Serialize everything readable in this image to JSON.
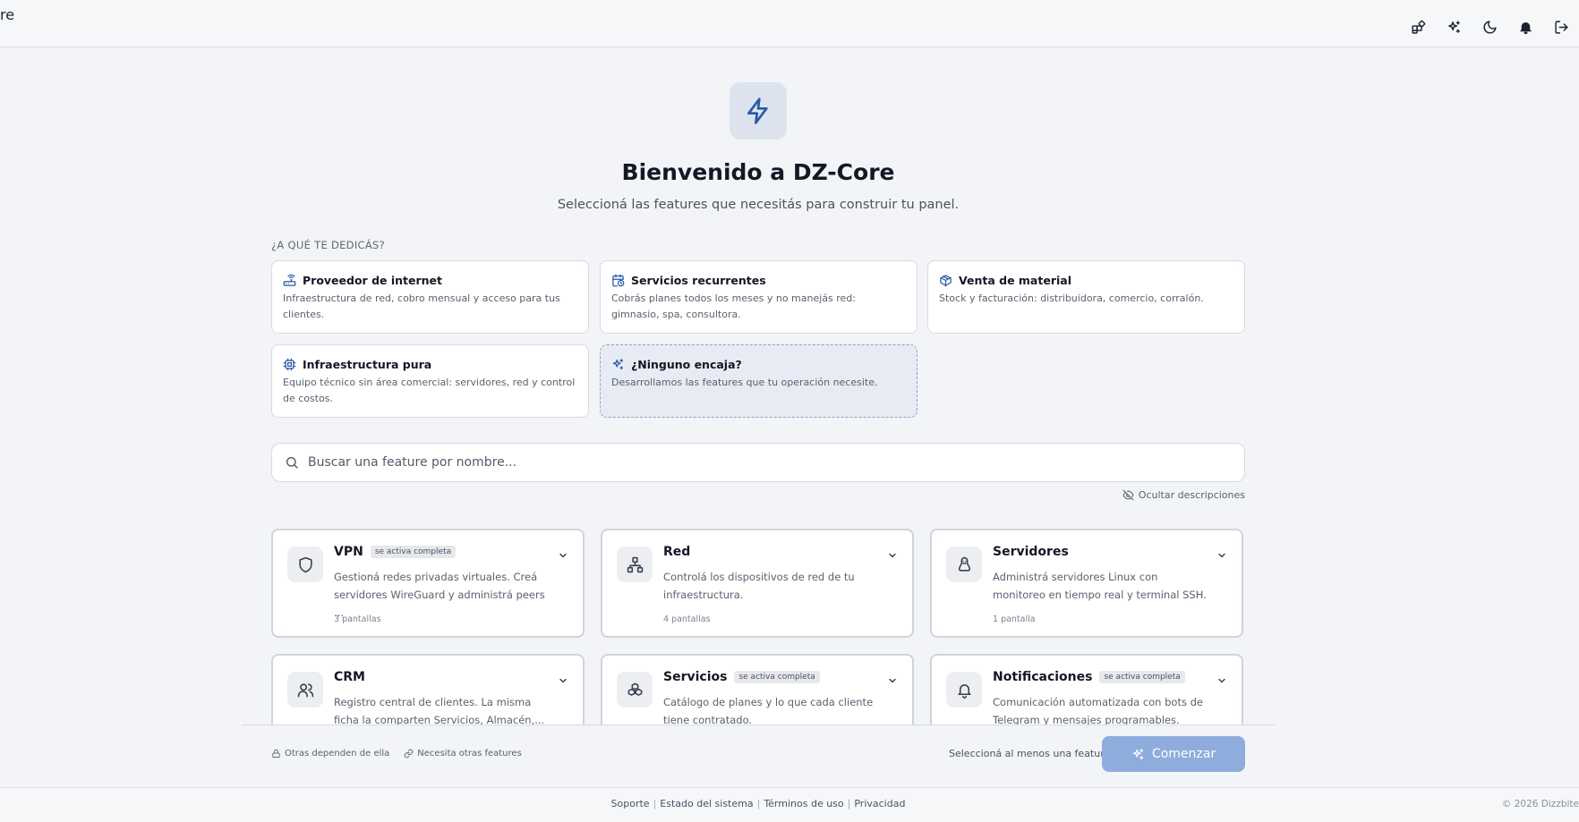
{
  "header": {
    "brand_fragment": "re",
    "icons": [
      "grid-icon",
      "sparkles-icon",
      "moon-icon",
      "bell-icon",
      "logout-icon"
    ]
  },
  "hero": {
    "icon": "bolt-icon",
    "title": "Bienvenido a DZ-Core",
    "subtitle": "Seleccioná las features que necesitás para construir tu panel."
  },
  "use_cases": {
    "label": "¿A QUÉ TE DEDICÁS?",
    "items": [
      {
        "title": "Proveedor de internet",
        "desc": "Infraestructura de red, cobro mensual y acceso para tus clientes.",
        "icon": "router-icon"
      },
      {
        "title": "Servicios recurrentes",
        "desc": "Cobrás planes todos los meses y no manejás red: gimnasio, spa, consultora.",
        "icon": "calendar-clock-icon"
      },
      {
        "title": "Venta de material",
        "desc": "Stock y facturación: distribuidora, comercio, corralón.",
        "icon": "package-icon"
      },
      {
        "title": "Infraestructura pura",
        "desc": "Equipo técnico sin área comercial: servidores, red y control de costos.",
        "icon": "chip-icon"
      },
      {
        "title": "¿Ninguno encaja?",
        "desc": "Desarrollamos las features que tu operación necesite.",
        "icon": "sparkles-icon"
      }
    ]
  },
  "search": {
    "placeholder": "Buscar una feature por nombre..."
  },
  "toggle_descriptions": "Ocultar descripciones",
  "features": [
    {
      "name": "VPN",
      "badge": "se activa completa",
      "desc": "Gestioná redes privadas virtuales. Creá servidores WireGuard y administrá peers ...",
      "count": "3 pantallas",
      "icon": "shield-icon"
    },
    {
      "name": "Red",
      "badge": "",
      "desc": "Controlá los dispositivos de red de tu infraestructura.",
      "count": "4 pantallas",
      "icon": "network-icon"
    },
    {
      "name": "Servidores",
      "badge": "",
      "desc": "Administrá servidores Linux con monitoreo en tiempo real y terminal SSH.",
      "count": "1 pantalla",
      "icon": "linux-icon"
    },
    {
      "name": "CRM",
      "badge": "",
      "desc": "Registro central de clientes. La misma ficha la comparten Servicios, Almacén,...",
      "count": "",
      "icon": "users-icon"
    },
    {
      "name": "Servicios",
      "badge": "se activa completa",
      "desc": "Catálogo de planes y lo que cada cliente tiene contratado.",
      "count": "",
      "icon": "boxes-icon"
    },
    {
      "name": "Notificaciones",
      "badge": "se activa completa",
      "desc": "Comunicación automatizada con bots de Telegram y mensajes programables.",
      "count": "",
      "icon": "bell-icon"
    }
  ],
  "bottom": {
    "legend_depended": "Otras dependen de ella",
    "legend_needs": "Necesita otras features",
    "hint": "Seleccioná al menos una feature",
    "start_label": "Comenzar"
  },
  "footer": {
    "links": [
      "Soporte",
      "Estado del sistema",
      "Términos de uso",
      "Privacidad"
    ],
    "copyright": "© 2026 Dizzbite"
  }
}
